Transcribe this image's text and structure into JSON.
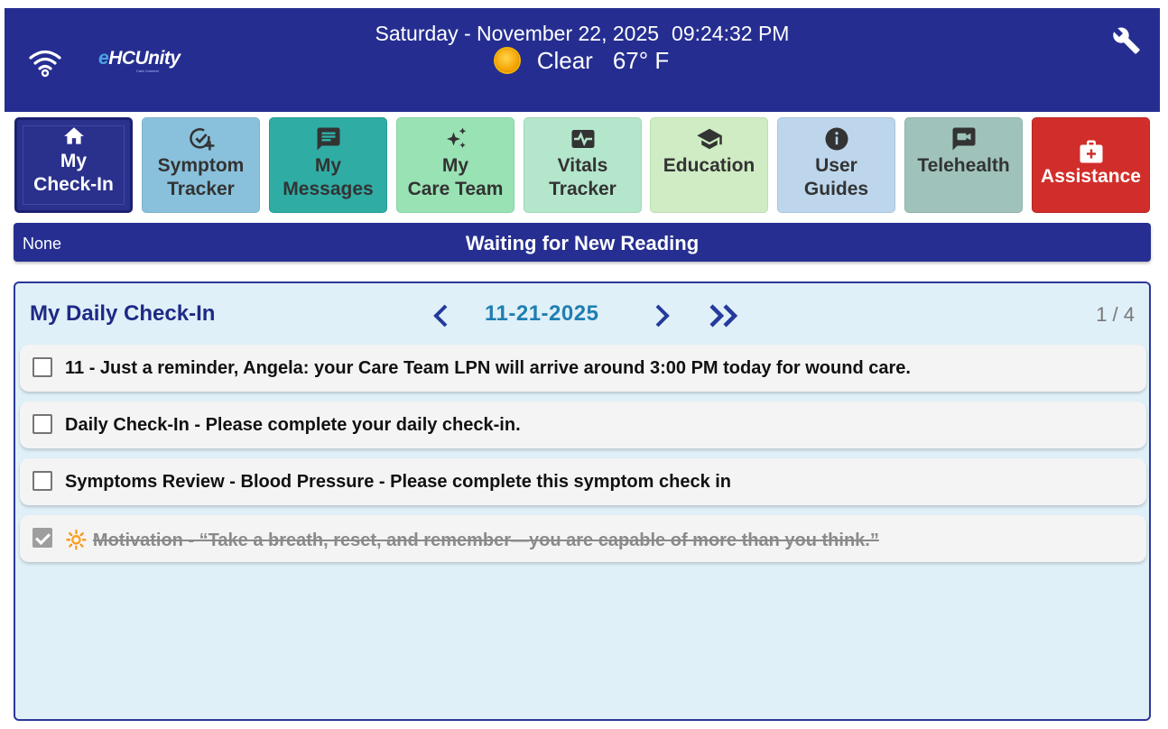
{
  "header": {
    "logo": "HCUnity",
    "logo_tagline": "Care Connect",
    "date": "Saturday - November 22, 2025",
    "time": "09:24:32 PM",
    "weather_condition": "Clear",
    "temperature": "67° F",
    "icons": [
      "wifi-icon",
      "sun-icon",
      "wrench-icon"
    ]
  },
  "nav": [
    {
      "label_1": "My",
      "label_2": "Check-In",
      "icon": "home-icon",
      "color": "#2a318c"
    },
    {
      "label_1": "Symptom",
      "label_2": "Tracker",
      "icon": "check-plus-icon",
      "color": "#89c1dc"
    },
    {
      "label_1": "My",
      "label_2": "Messages",
      "icon": "message-icon",
      "color": "#2fada5"
    },
    {
      "label_1": "My",
      "label_2": "Care Team",
      "icon": "sparkle-icon",
      "color": "#99e2b4"
    },
    {
      "label_1": "Vitals",
      "label_2": "Tracker",
      "icon": "vitals-icon",
      "color": "#b4e6cc"
    },
    {
      "label_1": "Education",
      "label_2": "",
      "icon": "graduation-cap-icon",
      "color": "#cfecc4"
    },
    {
      "label_1": "User",
      "label_2": "Guides",
      "icon": "info-icon",
      "color": "#bdd6ec"
    },
    {
      "label_1": "Telehealth",
      "label_2": "",
      "icon": "video-chat-icon",
      "color": "#9fc3bb"
    },
    {
      "label_1": "Assistance",
      "label_2": "",
      "icon": "first-aid-icon",
      "color": "#d12e2b"
    }
  ],
  "status": {
    "left": "None",
    "center": "Waiting for New Reading"
  },
  "checkin": {
    "title": "My Daily Check-In",
    "date": "11-21-2025",
    "page": "1 / 4",
    "tasks": [
      {
        "text": "11 - Just a reminder, Angela: your Care Team LPN will arrive around 3:00 PM today for wound care.",
        "checked": false
      },
      {
        "text": "Daily Check-In - Please complete your daily check-in.",
        "checked": false
      },
      {
        "text": "Symptoms Review - Blood Pressure - Please complete this symptom check in",
        "checked": false
      },
      {
        "emoji": "🔆",
        "text": "Motivation - “Take a breath, reset, and remember—you are capable of more than you think.”",
        "checked": true
      }
    ]
  }
}
